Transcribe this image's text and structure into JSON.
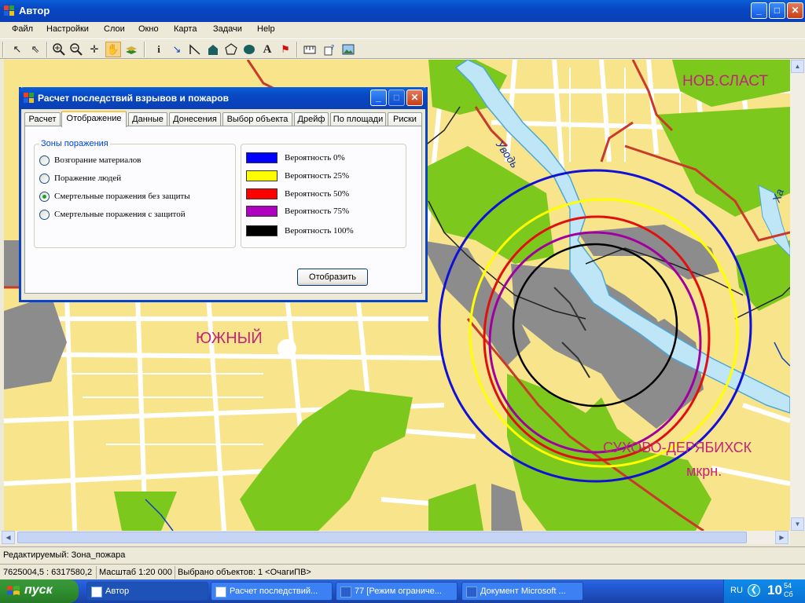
{
  "window": {
    "title": "Автор",
    "buttons": {
      "minimize": "_",
      "maximize": "□",
      "close": "✕"
    }
  },
  "menu": [
    "Файл",
    "Настройки",
    "Слои",
    "Окно",
    "Карта",
    "Задачи",
    "Help"
  ],
  "toolbar": {
    "tools": [
      "arrow-select-icon",
      "select-objects-icon",
      "zoom-in-icon",
      "zoom-out-icon",
      "move-icon",
      "pan-hand-icon",
      "layers-icon",
      "info-icon",
      "pin-icon",
      "polyline-icon",
      "house-icon",
      "polygon-icon",
      "ellipse-icon",
      "text-icon",
      "flag-icon",
      "ruler-icon",
      "settings-query-icon",
      "picture-icon"
    ],
    "active_tool": "pan-hand-icon"
  },
  "map": {
    "labels": {
      "yuzhny": "ЮЖНЫЙ",
      "nov_slast": "НОВ.СЛАСТ",
      "sukhovo": "СУХОВО-ДЕРЯБИХСК",
      "mkrn": "мкрн.",
      "uvod": "Уводь",
      "kha": "Ха"
    },
    "zone_colors": {
      "p0": "#0000FF",
      "p25": "#FFFF00",
      "p50": "#FF0000",
      "p75": "#B000C0",
      "p100": "#000000"
    }
  },
  "dialog": {
    "title": "Расчет последствий взрывов и пожаров",
    "tabs": [
      "Расчет",
      "Отображение",
      "Данные",
      "Донесения",
      "Выбор объекта",
      "Дрейф",
      "По площади",
      "Риски"
    ],
    "active_tab": "Отображение",
    "zones_group": {
      "legend": "Зоны поражения",
      "options": [
        {
          "label": "Возгорание материалов",
          "checked": false
        },
        {
          "label": "Поражение людей",
          "checked": false
        },
        {
          "label": "Смертельные поражения без защиты",
          "checked": true
        },
        {
          "label": "Смертельные поражения с защитой",
          "checked": false
        }
      ]
    },
    "probabilities": [
      {
        "label": "Вероятность 0%",
        "color": "#0000FF"
      },
      {
        "label": "Вероятность 25%",
        "color": "#FFFF00"
      },
      {
        "label": "Вероятность 50%",
        "color": "#FF0000"
      },
      {
        "label": "Вероятность 75%",
        "color": "#B000C0"
      },
      {
        "label": "Вероятность 100%",
        "color": "#000000"
      }
    ],
    "show_button": "Отобразить"
  },
  "status": {
    "editable": "Редактируемый: Зона_пожара",
    "coords": "7625004,5 : 6317580,2",
    "scale": "Масштаб 1:20 000",
    "selected": "Выбрано объектов: 1 <ОчагиПВ>"
  },
  "taskbar": {
    "start": "пуск",
    "tasks": [
      {
        "label": "Автор",
        "active": true
      },
      {
        "label": "Расчет последствий...",
        "active": false
      },
      {
        "label": "77 [Режим ограниче...",
        "active": false
      },
      {
        "label": "Документ Microsoft ...",
        "active": false
      }
    ],
    "lang": "RU",
    "time_hour": "10",
    "time_min": "54",
    "day": "Сб"
  }
}
